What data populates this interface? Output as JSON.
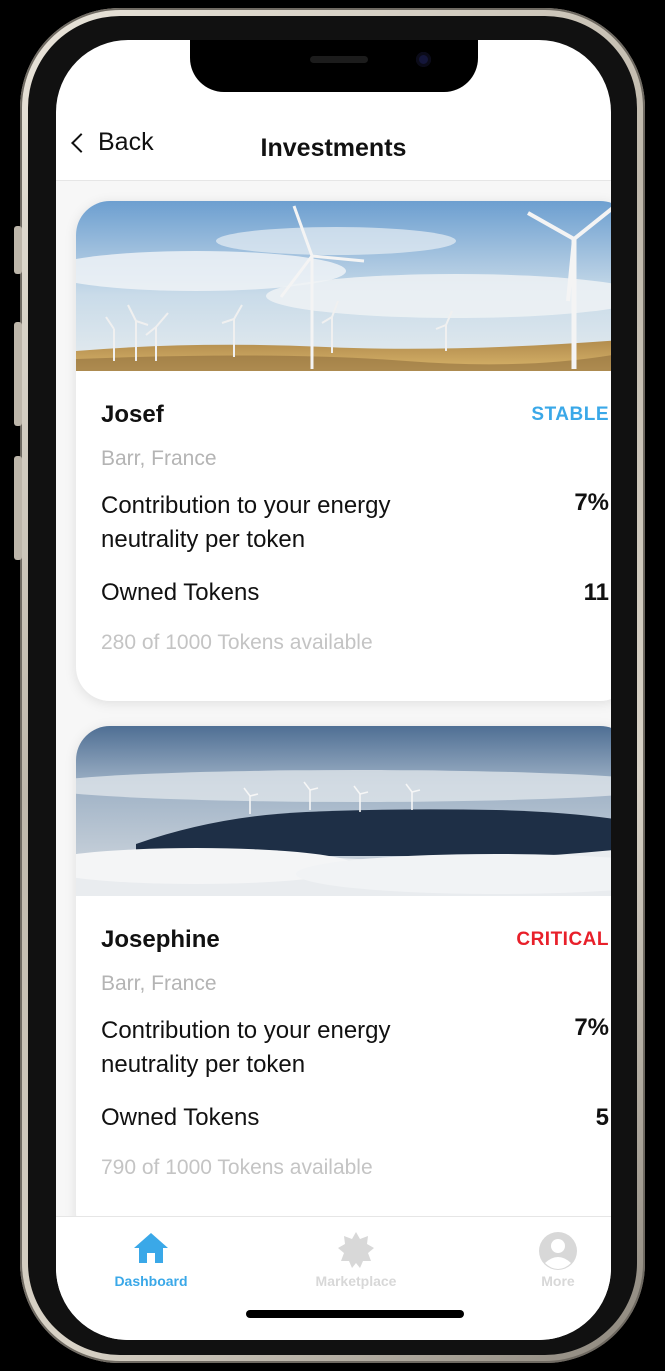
{
  "nav": {
    "back_label": "Back",
    "title": "Investments"
  },
  "investments": [
    {
      "name": "Josef",
      "status": "STABLE",
      "status_color": "#3aa8e8",
      "location": "Barr, France",
      "contribution_label": "Contribution to your energy neutrality per token",
      "contribution_value": "7%",
      "owned_label": "Owned Tokens",
      "owned_value": "11",
      "availability": "280 of 1000 Tokens available"
    },
    {
      "name": "Josephine",
      "status": "CRITICAL",
      "status_color": "#e8202a",
      "location": "Barr, France",
      "contribution_label": "Contribution to your energy neutrality per token",
      "contribution_value": "7%",
      "owned_label": "Owned Tokens",
      "owned_value": "5",
      "availability": "790 of 1000 Tokens available"
    }
  ],
  "tabbar": {
    "tabs": [
      {
        "label": "Dashboard",
        "icon": "home-icon",
        "active": true,
        "color": "#3aa8e8"
      },
      {
        "label": "Marketplace",
        "icon": "badge-icon",
        "active": false,
        "color": "#d8d8d8"
      },
      {
        "label": "More",
        "icon": "user-circle-icon",
        "active": false,
        "color": "#d8d8d8"
      }
    ]
  },
  "colors": {
    "accent": "#3aa8e8",
    "critical": "#e8202a"
  }
}
